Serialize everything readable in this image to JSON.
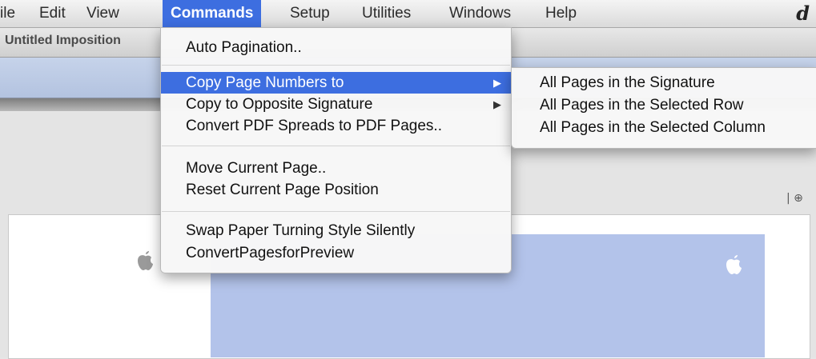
{
  "menubar": {
    "items": [
      "ile",
      "Edit",
      "View",
      "Commands",
      "Setup",
      "Utilities",
      "Windows",
      "Help"
    ],
    "active_index": 3,
    "app_logo": "d"
  },
  "window": {
    "title": "Untitled Imposition"
  },
  "commands_menu": {
    "items": [
      {
        "label": "Auto Pagination..",
        "submenu": false
      },
      {
        "label": "Copy Page Numbers to",
        "submenu": true,
        "highlighted": true
      },
      {
        "label": "Copy to Opposite Signature",
        "submenu": true
      },
      {
        "label": "Convert PDF Spreads to PDF Pages..",
        "submenu": false
      },
      {
        "label": "Move Current Page..",
        "submenu": false
      },
      {
        "label": "Reset Current Page Position",
        "submenu": false
      },
      {
        "label": "Swap Paper Turning Style Silently",
        "submenu": false
      },
      {
        "label": "ConvertPagesforPreview",
        "submenu": false
      }
    ],
    "submenu_arrow": "▶"
  },
  "copy_page_numbers_submenu": {
    "items": [
      "All Pages in the Signature",
      "All Pages in the Selected Row",
      "All Pages in the Selected Column"
    ]
  },
  "canvas": {
    "ruler_marker": "| ⊕",
    "page_color": "#b3c3ea",
    "accent": "#3d6ee0"
  }
}
